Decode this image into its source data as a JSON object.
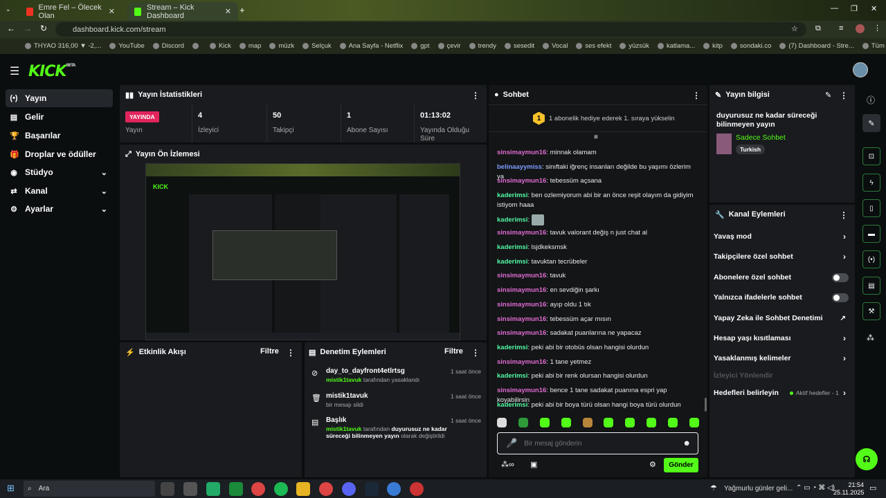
{
  "browser": {
    "tabs": [
      {
        "title": "Emre Fel – Ölecek Olan"
      },
      {
        "title": "Stream – Kick Dashboard"
      }
    ],
    "url": "dashboard.kick.com/stream",
    "bookmarks": [
      "THYAO 316,00 ▼ -2,...",
      "YouTube",
      "Discord",
      "",
      "Kick",
      "map",
      "müzk",
      "Selçuk",
      "Ana Sayfa - Netflix",
      "gpt",
      "çevir",
      "trendy",
      "sesedit",
      "Vocal",
      "ses efekt",
      "yüzsük",
      "katlama...",
      "kitp",
      "sondaki.co",
      "(7) Dashboard - Stre...",
      "Tüm Yer İşaretleri"
    ]
  },
  "logo": {
    "text": "KICK",
    "beta": "BETA"
  },
  "sidebar": [
    {
      "icon": "(•)",
      "label": "Yayın"
    },
    {
      "icon": "▤",
      "label": "Gelir"
    },
    {
      "icon": "🏆",
      "label": "Başarılar"
    },
    {
      "icon": "🎁",
      "label": "Droplar ve ödüller"
    },
    {
      "icon": "◉",
      "label": "Stüdyo"
    },
    {
      "icon": "⇄",
      "label": "Kanal"
    },
    {
      "icon": "⚙",
      "label": "Ayarlar"
    }
  ],
  "stats": {
    "title": "Yayın İstatistikleri",
    "live_badge": "YAYINDA",
    "live_label": "Yayın",
    "items": [
      {
        "value": "4",
        "label": "İzleyici"
      },
      {
        "value": "50",
        "label": "Takipçi"
      },
      {
        "value": "1",
        "label": "Abone Sayısı"
      },
      {
        "value": "01:13:02",
        "label": "Yayında Olduğu Süre"
      }
    ]
  },
  "preview": {
    "title": "Yayın Ön İzlemesi"
  },
  "activity": {
    "title": "Etkinlik Akışı",
    "filter": "Filtre"
  },
  "moderation": {
    "title": "Denetim Eylemleri",
    "filter": "Filtre",
    "items": [
      {
        "title": "day_to_dayfront4etlrtsg",
        "who": "mistik1tavuk",
        "rest": " tarafından yasaklandı",
        "time": "1 saat önce"
      },
      {
        "title": "mistik1tavuk",
        "who": "",
        "rest": "bir mesajı sildi",
        "time": "1 saat önce"
      },
      {
        "title": "Başlık",
        "who": "mistik1tavuk",
        "rest": " tarafından ",
        "bold": "duyurusuz ne kadar süreceği bilinmeyen yayın",
        "tail": " olarak değiştirildi",
        "time": "1 saat önce"
      }
    ]
  },
  "chat": {
    "title": "Sohbet",
    "promo_count": "1",
    "promo": "1 abonelik hediye ederek 1. sıraya yükselin",
    "messages": [
      {
        "user": "sinsimaymun16",
        "color": "pink",
        "text": "minnak olamam"
      },
      {
        "user": "belinaayymiss",
        "color": "blue",
        "text": "sinıftaki iğrenç insanları değilde bu yaşımı özlerim ya"
      },
      {
        "user": "sinsimaymun16",
        "color": "pink",
        "text": "tebessüm açsana"
      },
      {
        "user": "kaderimsi",
        "color": "green",
        "text": "ben ozlemiyorum abi bir an önce reşit olayım da gidiyim istiyom haaa"
      },
      {
        "user": "kaderimsi",
        "color": "green",
        "text": ""
      },
      {
        "user": "sinsimaymun16",
        "color": "pink",
        "text": "tavuk valorant değiş n just chat al"
      },
      {
        "user": "kaderimsi",
        "color": "green",
        "text": "lsjdkeksmsk"
      },
      {
        "user": "kaderimsi",
        "color": "green",
        "text": "tavuktan tecrübeler"
      },
      {
        "user": "sinsimaymun16",
        "color": "pink",
        "text": "tavuk"
      },
      {
        "user": "sinsimaymun16",
        "color": "pink",
        "text": "en sevdiğin şarkı"
      },
      {
        "user": "sinsimaymun16",
        "color": "pink",
        "text": "ayıp oldu 1 tık"
      },
      {
        "user": "sinsimaymun16",
        "color": "pink",
        "text": "tebessüm açar mısın"
      },
      {
        "user": "sinsimaymun16",
        "color": "pink",
        "text": "sadakat puanlarına ne yapacaz"
      },
      {
        "user": "kaderimsi",
        "color": "green",
        "text": "peki abi bir otobüs olsan hangisi olurdun"
      },
      {
        "user": "sinsimaymun16",
        "color": "pink",
        "text": "1 tane yetmez"
      },
      {
        "user": "kaderimsi",
        "color": "green",
        "text": "peki abi bir renk olursan hangisi olurdun"
      },
      {
        "user": "sinsimaymun16",
        "color": "pink",
        "text": "bence 1 tane sadakat puanına espri yap koyabilirsin"
      },
      {
        "user": "kaderimsi",
        "color": "green",
        "text": "peki abi bir boya türü olsan hangi boya türü olurdun"
      }
    ],
    "placeholder": "Bir mesaj gönderin",
    "send": "Gönder"
  },
  "stream_info": {
    "title": "Yayın bilgisi",
    "stream_title": "duyurusuz ne kadar süreceği bilinmeyen yayın",
    "category": "Sadece Sohbet",
    "tag": "Turkish"
  },
  "channel_actions": {
    "title": "Kanal Eylemleri",
    "items": [
      {
        "label": "Yavaş mod",
        "kind": "chev"
      },
      {
        "label": "Takipçilere özel sohbet",
        "kind": "chev"
      },
      {
        "label": "Abonelere özel sohbet",
        "kind": "toggle"
      },
      {
        "label": "Yalnızca ifadelerle sohbet",
        "kind": "toggle"
      },
      {
        "label": "Yapay Zeka ile Sohbet Denetimi",
        "kind": "ext"
      },
      {
        "label": "Hesap yaşı kısıtlaması",
        "kind": "chev"
      },
      {
        "label": "Yasaklanmış kelimeler",
        "kind": "chev"
      },
      {
        "label": "İzleyici Yönlendir",
        "kind": "dim"
      },
      {
        "label": "Hedefleri belirleyin",
        "kind": "goal",
        "extra": "Aktif hedefler - 1"
      }
    ]
  },
  "taskbar": {
    "search": "Ara",
    "weather": "Yağmurlu günler geli...",
    "time": "21:54",
    "date": "25.11.2025"
  },
  "colors": {
    "accent": "#53fc18",
    "live": "#e1255c",
    "panel": "#191b1f"
  }
}
